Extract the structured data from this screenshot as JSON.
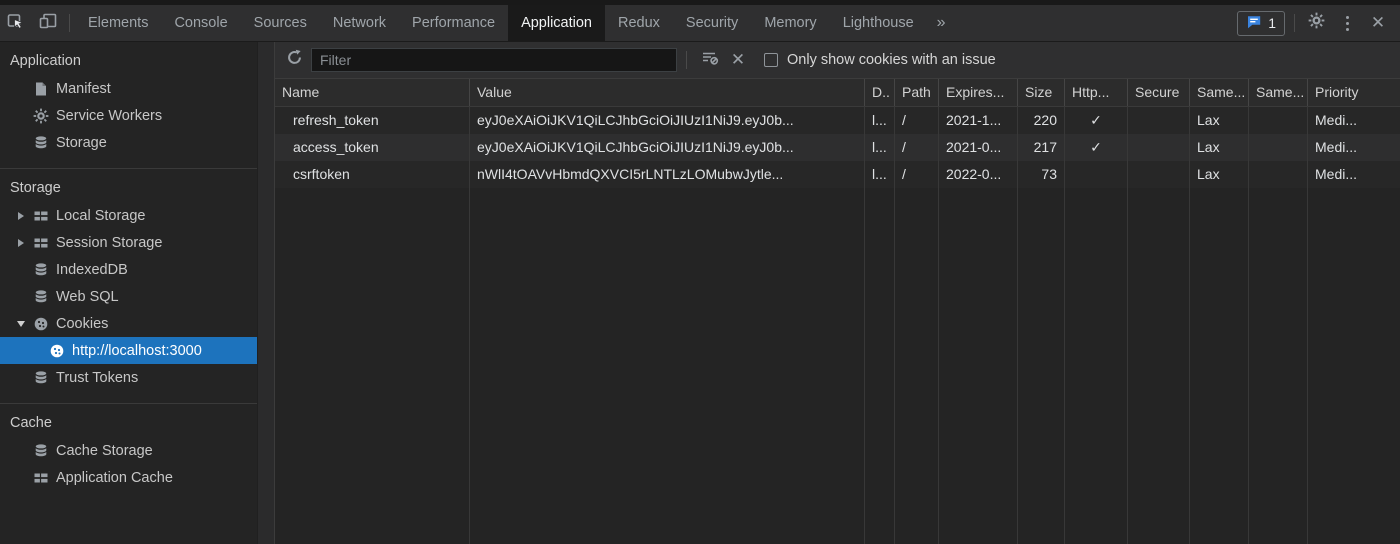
{
  "colors": {
    "selection_blue": "#1d73bd",
    "flag_blue": "#3a84e0",
    "toolbar_bg": "#2f2f30",
    "panel_bg": "#242424"
  },
  "tabbar": {
    "tabs": [
      "Elements",
      "Console",
      "Sources",
      "Network",
      "Performance",
      "Application",
      "Redux",
      "Security",
      "Memory",
      "Lighthouse"
    ],
    "active_tab": "Application",
    "more_tabs": "»",
    "issue_count": "1"
  },
  "sidebar": {
    "sections": [
      {
        "title": "Application",
        "items": [
          {
            "icon": "file-icon",
            "label": "Manifest"
          },
          {
            "icon": "gear-icon",
            "label": "Service Workers"
          },
          {
            "icon": "database-icon",
            "label": "Storage"
          }
        ]
      },
      {
        "title": "Storage",
        "items": [
          {
            "icon": "table-icon",
            "label": "Local Storage",
            "disclosure": "collapsed"
          },
          {
            "icon": "table-icon",
            "label": "Session Storage",
            "disclosure": "collapsed"
          },
          {
            "icon": "database-icon",
            "label": "IndexedDB"
          },
          {
            "icon": "database-icon",
            "label": "Web SQL"
          },
          {
            "icon": "cookie-icon",
            "label": "Cookies",
            "disclosure": "expanded"
          },
          {
            "icon": "cookie-icon",
            "label": "http://localhost:3000",
            "child": true,
            "selected": true
          },
          {
            "icon": "database-icon",
            "label": "Trust Tokens"
          }
        ]
      },
      {
        "title": "Cache",
        "items": [
          {
            "icon": "database-icon",
            "label": "Cache Storage"
          },
          {
            "icon": "table-icon",
            "label": "Application Cache"
          }
        ]
      }
    ]
  },
  "toolbar": {
    "filter_placeholder": "Filter",
    "only_issues_label": "Only show cookies with an issue",
    "checkbox_checked": false
  },
  "cookie_table": {
    "columns": [
      "Name",
      "Value",
      "D..",
      "Path",
      "Expires...",
      "Size",
      "Http...",
      "Secure",
      "Same...",
      "Same...",
      "Priority"
    ],
    "rows": [
      [
        "refresh_token",
        "eyJ0eXAiOiJKV1QiLCJhbGciOiJIUzI1NiJ9.eyJ0b...",
        "l...",
        "/",
        "2021-1...",
        "220",
        "✓",
        "",
        "Lax",
        "",
        "Medi..."
      ],
      [
        "access_token",
        "eyJ0eXAiOiJKV1QiLCJhbGciOiJIUzI1NiJ9.eyJ0b...",
        "l...",
        "/",
        "2021-0...",
        "217",
        "✓",
        "",
        "Lax",
        "",
        "Medi..."
      ],
      [
        "csrftoken",
        "nWlI4tOAVvHbmdQXVCI5rLNTLzLOMubwJytle...",
        "l...",
        "/",
        "2022-0...",
        "73",
        "",
        "",
        "Lax",
        "",
        "Medi..."
      ]
    ]
  }
}
